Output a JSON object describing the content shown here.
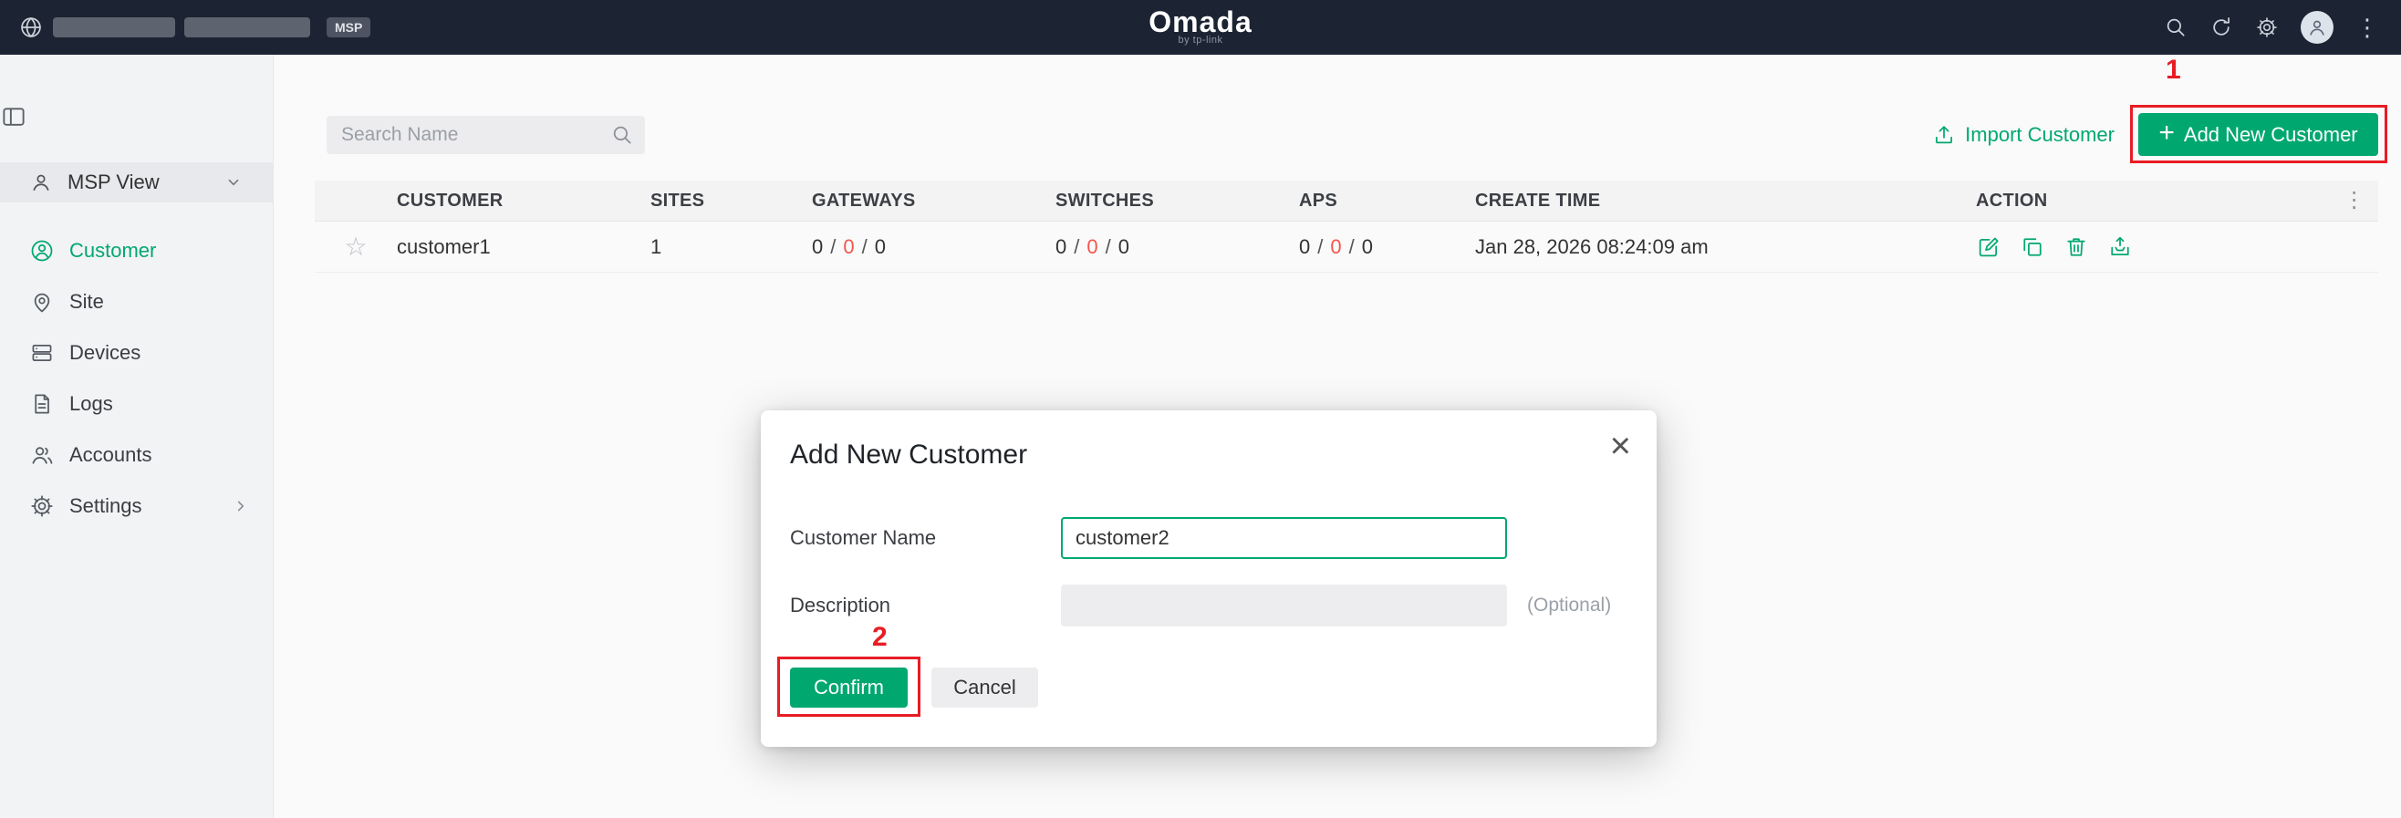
{
  "topbar": {
    "msp_badge": "MSP",
    "logo": "Omada",
    "logo_sub": "by tp-link"
  },
  "sidebar": {
    "view_label": "MSP View",
    "items": [
      {
        "label": "Customer"
      },
      {
        "label": "Site"
      },
      {
        "label": "Devices"
      },
      {
        "label": "Logs"
      },
      {
        "label": "Accounts"
      },
      {
        "label": "Settings"
      }
    ]
  },
  "toolbar": {
    "search_placeholder": "Search Name",
    "import_label": "Import Customer",
    "add_label": "Add New Customer"
  },
  "table": {
    "counts_separator": "/",
    "headers": {
      "customer": "CUSTOMER",
      "sites": "SITES",
      "gateways": "GATEWAYS",
      "switches": "SWITCHES",
      "aps": "APS",
      "create_time": "CREATE TIME",
      "action": "ACTION"
    },
    "rows": [
      {
        "customer": "customer1",
        "sites": "1",
        "gateways": [
          "0",
          "0",
          "0"
        ],
        "switches": [
          "0",
          "0",
          "0"
        ],
        "aps": [
          "0",
          "0",
          "0"
        ],
        "create_time": "Jan 28, 2026 08:24:09 am"
      }
    ]
  },
  "modal": {
    "title": "Add New Customer",
    "customer_name_label": "Customer Name",
    "customer_name_value": "customer2",
    "description_label": "Description",
    "description_value": "",
    "optional_hint": "(Optional)",
    "confirm_label": "Confirm",
    "cancel_label": "Cancel"
  },
  "annotations": {
    "step1": "1",
    "step2": "2"
  },
  "icons": {
    "plus": "+",
    "close": "×",
    "kebab_vertical": "⋮",
    "star": "☆"
  },
  "colors": {
    "accent_green": "#00a870",
    "alert_red": "#f2564d",
    "annotation_red": "#e81c24",
    "topbar_bg": "#1c2433"
  }
}
